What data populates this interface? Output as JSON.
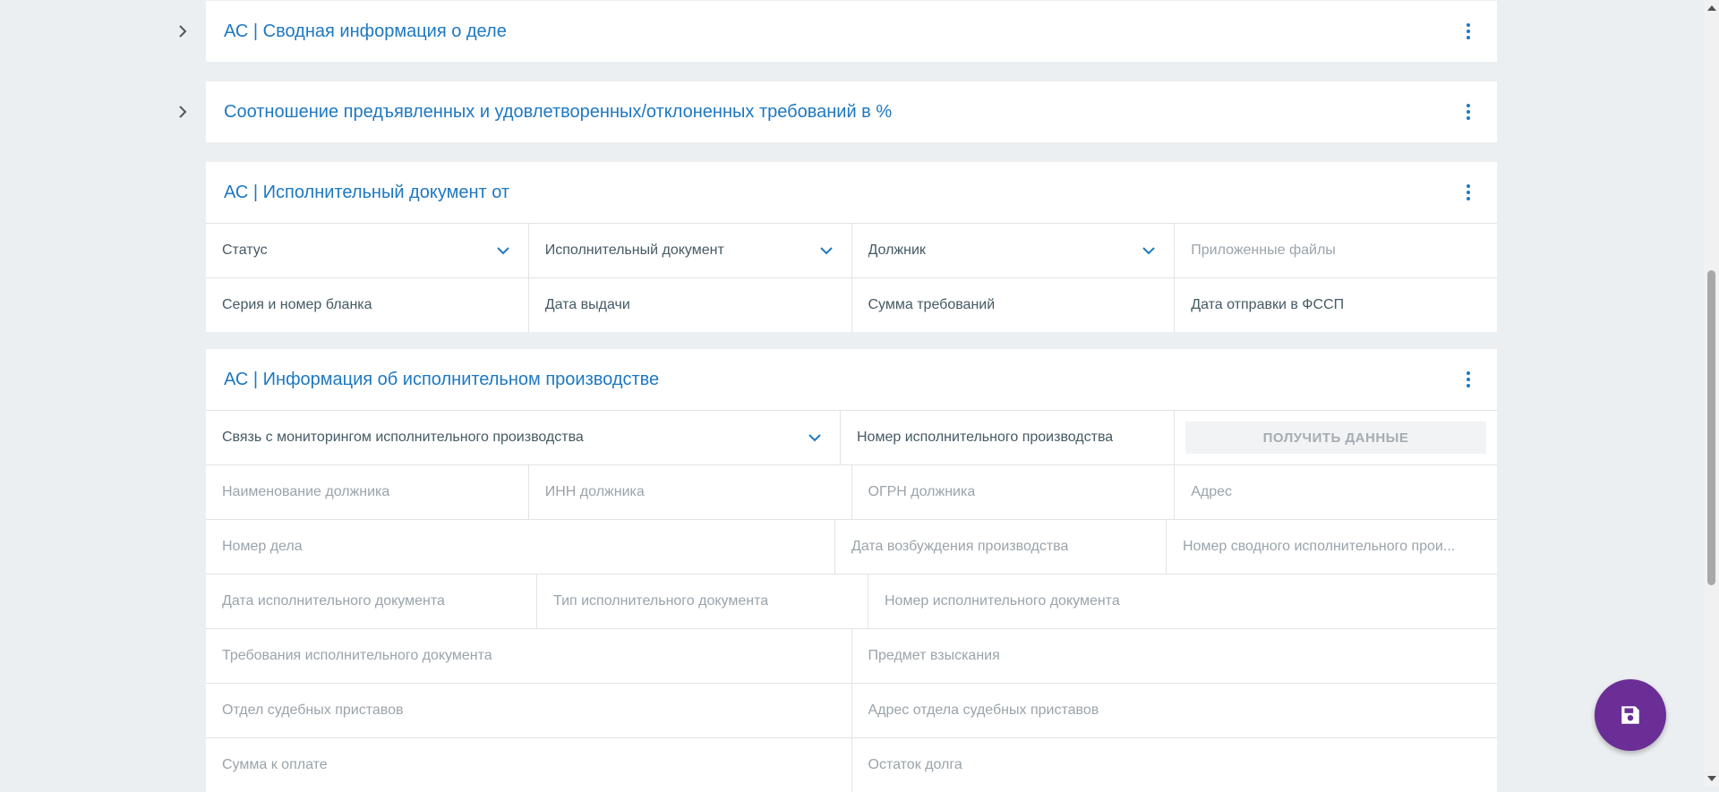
{
  "cards": {
    "summary": {
      "title": "АС | Сводная информация о деле"
    },
    "ratio": {
      "title": "Соотношение предъявленных и удовлетворенных/отклоненных требований в %"
    },
    "exec_doc": {
      "title": "АС | Исполнительный документ от",
      "row1": [
        "Статус",
        "Исполнительный документ",
        "Должник",
        "Приложенные файлы"
      ],
      "row2": [
        "Серия и номер бланка",
        "Дата выдачи",
        "Сумма требований",
        "Дата отправки в ФССП"
      ]
    },
    "exec_proc": {
      "title": "АС | Информация об исполнительном производстве",
      "link_field": "Связь с мониторингом исполнительного производства",
      "proc_number": "Номер исполнительного производства",
      "get_data_button": "ПОЛУЧИТЬ ДАННЫЕ",
      "debtor_row": [
        "Наименование должника",
        "ИНН должника",
        "ОГРН должника",
        "Адрес"
      ],
      "case_number": "Номер дела",
      "start_date": "Дата возбуждения производства",
      "summary_proc_number": "Номер сводного исполнительного прои...",
      "doc_date": "Дата исполнительного документа",
      "doc_type": "Тип исполнительного документа",
      "doc_number": "Номер исполнительного документа",
      "doc_requirements": "Требования исполнительного документа",
      "subject": "Предмет взыскания",
      "bailiff_dept": "Отдел судебных приставов",
      "bailiff_address": "Адрес отдела судебных приставов",
      "amount_due": "Сумма к оплате",
      "debt_remainder": "Остаток долга"
    }
  },
  "colors": {
    "accent": "#1e78c2",
    "fab": "#6a2e96"
  },
  "icons": {
    "expand": "chevron-right-icon",
    "menu": "more-vert-icon",
    "dropdown": "chevron-down-icon",
    "save": "save-icon"
  }
}
